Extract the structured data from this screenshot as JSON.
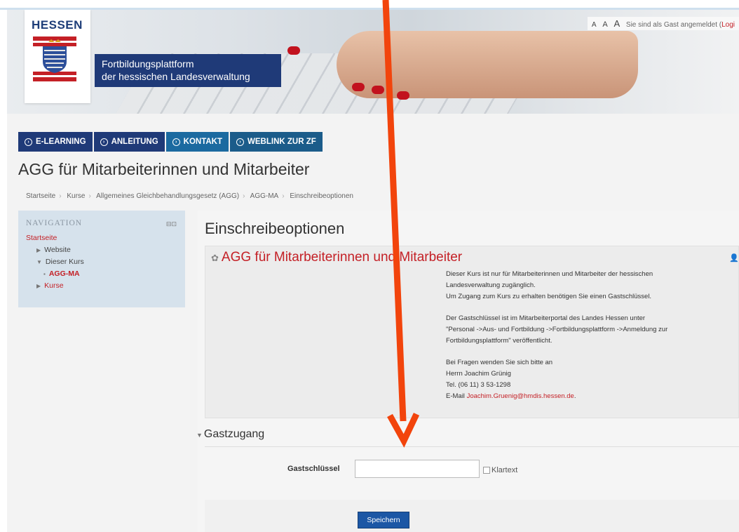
{
  "header": {
    "logo_text": "HESSEN",
    "platform_title_line1": "Fortbildungsplattform",
    "platform_title_line2": "der hessischen Landesverwaltung",
    "font_size_a1": "A",
    "font_size_a2": "A",
    "font_size_a3": "A",
    "guest_status": "Sie sind als Gast angemeldet (",
    "login_label": "Logi"
  },
  "mainnav": {
    "items": [
      {
        "label": "E-LEARNING"
      },
      {
        "label": "ANLEITUNG"
      },
      {
        "label": "KONTAKT"
      },
      {
        "label": "WEBLINK ZUR ZF"
      }
    ]
  },
  "page_title": "AGG für Mitarbeiterinnen und Mitarbeiter",
  "breadcrumb": [
    "Startseite",
    "Kurse",
    "Allgemeines Gleichbehandlungsgesetz (AGG)",
    "AGG-MA",
    "Einschreibeoptionen"
  ],
  "navigation": {
    "title": "NAVIGATION",
    "items": {
      "home": "Startseite",
      "website": "Website",
      "this_course": "Dieser Kurs",
      "course_short": "AGG-MA",
      "courses": "Kurse"
    }
  },
  "main": {
    "heading": "Einschreibeoptionen",
    "course_name": "AGG für Mitarbeiterinnen und Mitarbeiter",
    "summary": {
      "p1_line1": "Dieser Kurs ist nur für Mitarbeiterinnen und Mitarbeiter der hessischen",
      "p1_line2": "Landesverwaltung zugänglich.",
      "p1_line3": "Um Zugang zum Kurs zu erhalten benötigen Sie einen Gastschlüssel.",
      "p2_line1": "Der Gastschlüssel ist im Mitarbeiterportal des Landes Hessen unter",
      "p2_line2": "\"Personal ->Aus- und Fortbildung ->Fortbildungsplattform ->Anmeldung zur",
      "p2_line3": "Fortbildungsplattform\" veröffentlicht.",
      "p3_line1": "Bei Fragen wenden Sie sich bitte an",
      "p3_line2": "Herrn Joachim Grünig",
      "p3_line3": "Tel. (06 11) 3 53-1298",
      "p3_mail_prefix": "E-Mail ",
      "p3_mail": "Joachim.Gruenig@hmdis.hessen.de",
      "p3_mail_suffix": "."
    },
    "guest_section": {
      "title": "Gastzugang",
      "key_label": "Gastschlüssel",
      "key_value": "",
      "plaintext_label": "Klartext",
      "save_label": "Speichern"
    }
  },
  "colors": {
    "brand_blue": "#1f3a78",
    "accent_red": "#c42026",
    "arrow": "#f2440c"
  }
}
